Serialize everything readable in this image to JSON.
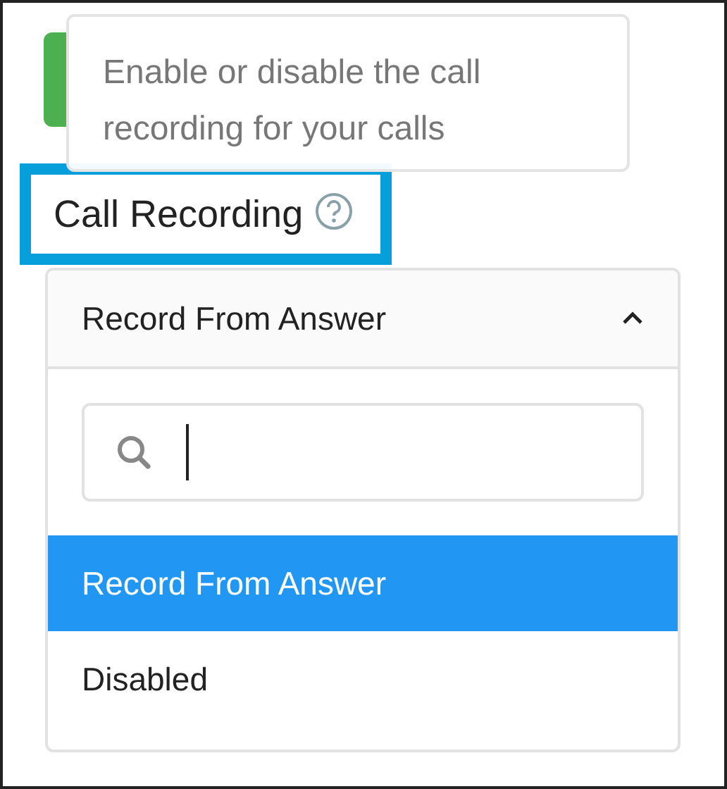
{
  "tooltip": {
    "text": "Enable or disable the call recording for your calls"
  },
  "field": {
    "label": "Call Recording",
    "highlighted": true
  },
  "dropdown": {
    "value": "Record From Answer",
    "expanded": true,
    "options": [
      {
        "label": "Record From Answer",
        "selected": true
      },
      {
        "label": "Disabled",
        "selected": false
      }
    ]
  }
}
